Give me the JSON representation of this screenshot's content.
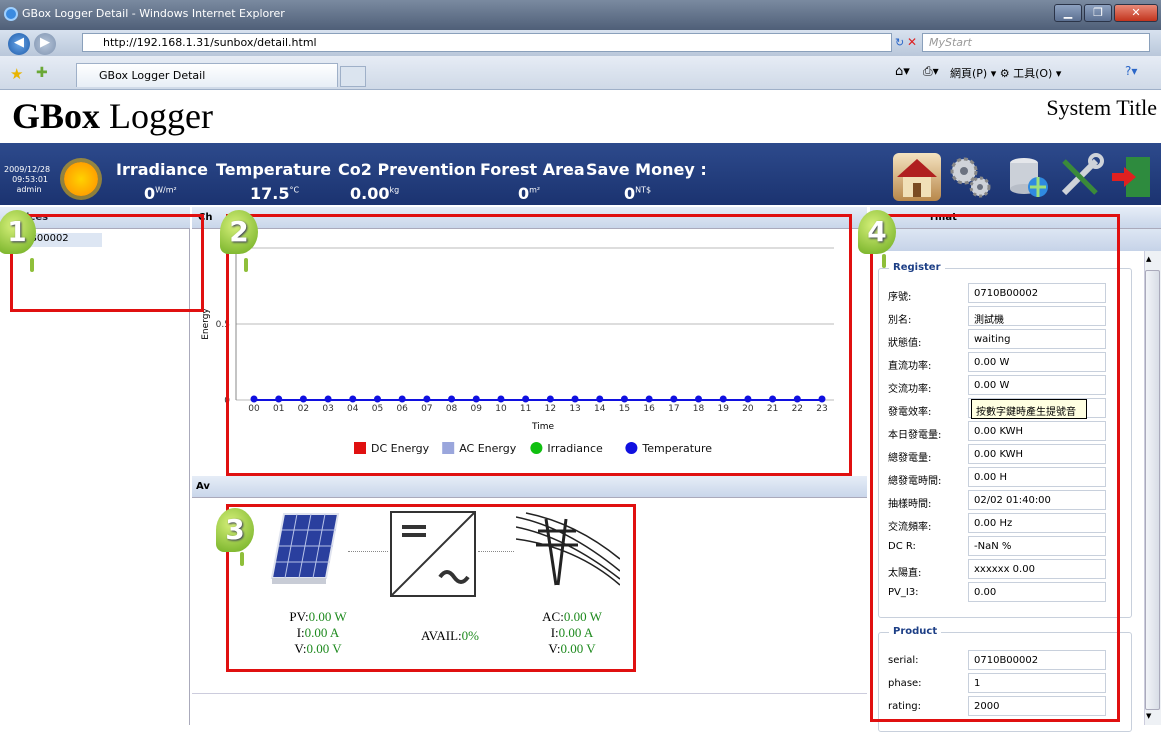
{
  "browser": {
    "window_title": "GBox Logger Detail - Windows Internet Explorer",
    "url": "http://192.168.1.31/sunbox/detail.html",
    "search_placeholder": "MyStart",
    "tab_title": "GBox Logger Detail",
    "command_bar": "網頁(P) ▾  ⚙ 工具(O) ▾"
  },
  "page": {
    "logo_bold": "GBox",
    "logo_rest": " Logger",
    "system_title": "System Title"
  },
  "header": {
    "date": "2009/12/28",
    "time": "09:53:01",
    "user": "admin",
    "metrics": [
      {
        "label": "Irradiance",
        "value": "0",
        "unit": "W/m²"
      },
      {
        "label": "Temperature",
        "value": "17.5",
        "unit": "°C"
      },
      {
        "label": "Co2 Prevention",
        "value": "0.00",
        "unit": "kg"
      },
      {
        "label": "Forest Area",
        "value": "0",
        "unit": "m²"
      },
      {
        "label": "Save Money :",
        "value": "0",
        "unit": "NT$"
      }
    ]
  },
  "devices": {
    "heading": "ices",
    "item": "B00002"
  },
  "chart_panel": {
    "heading": "Ch"
  },
  "chart_data": {
    "type": "line",
    "categories": [
      "00",
      "01",
      "02",
      "03",
      "04",
      "05",
      "06",
      "07",
      "08",
      "09",
      "10",
      "11",
      "12",
      "13",
      "14",
      "15",
      "16",
      "17",
      "18",
      "19",
      "20",
      "21",
      "22",
      "23"
    ],
    "series": [
      {
        "name": "DC Energy",
        "color": "#e01010",
        "values": [
          0,
          0,
          0,
          0,
          0,
          0,
          0,
          0,
          0,
          0,
          0,
          0,
          0,
          0,
          0,
          0,
          0,
          0,
          0,
          0,
          0,
          0,
          0,
          0
        ]
      },
      {
        "name": "AC Energy",
        "color": "#9aa6dc",
        "values": [
          0,
          0,
          0,
          0,
          0,
          0,
          0,
          0,
          0,
          0,
          0,
          0,
          0,
          0,
          0,
          0,
          0,
          0,
          0,
          0,
          0,
          0,
          0,
          0
        ]
      },
      {
        "name": "Irradiance",
        "color": "#10c010",
        "values": [
          0,
          0,
          0,
          0,
          0,
          0,
          0,
          0,
          0,
          0,
          0,
          0,
          0,
          0,
          0,
          0,
          0,
          0,
          0,
          0,
          0,
          0,
          0,
          0
        ]
      },
      {
        "name": "Temperature",
        "color": "#1010e0",
        "values": [
          0,
          0,
          0,
          0,
          0,
          0,
          0,
          0,
          0,
          0,
          0,
          0,
          0,
          0,
          0,
          0,
          0,
          0,
          0,
          0,
          0,
          0,
          0,
          0
        ]
      }
    ],
    "xlabel": "Time",
    "ylabel": "Energy",
    "ylim": [
      0,
      1
    ],
    "yticks": [
      "0",
      "0.5"
    ],
    "grid": true,
    "legend": "bottom"
  },
  "avail": {
    "heading": "Av",
    "pv_power": "0.00 W",
    "pv_current": "0.00 A",
    "pv_voltage": "0.00 V",
    "avail": "0%",
    "ac_power": "0.00 W",
    "ac_current": "0.00 A",
    "ac_voltage": "0.00 V",
    "pv_label": "PV:",
    "i_label": "I:",
    "v_label": "V:",
    "avail_label": "AVAIL:",
    "ac_label": "AC:"
  },
  "right": {
    "heading": "rmat",
    "register_legend": "Register",
    "register": [
      {
        "label": "序號:",
        "value": "0710B00002"
      },
      {
        "label": "別名:",
        "value": "測試機"
      },
      {
        "label": "狀態值:",
        "value": "waiting"
      },
      {
        "label": "直流功率:",
        "value": "0.00 W"
      },
      {
        "label": "交流功率:",
        "value": "0.00 W"
      },
      {
        "label": "發電效率:",
        "value": ""
      },
      {
        "label": "本日發電量:",
        "value": "0.00 KWH"
      },
      {
        "label": "總發電量:",
        "value": "0.00 KWH"
      },
      {
        "label": "總發電時間:",
        "value": "0.00 H"
      },
      {
        "label": "抽樣時間:",
        "value": "02/02 01:40:00"
      },
      {
        "label": "交流頻率:",
        "value": "0.00 Hz"
      },
      {
        "label": "DC R:",
        "value": "-NaN %"
      },
      {
        "label": "太陽直:",
        "value": "xxxxxx   0.00"
      },
      {
        "label": "PV_I3:",
        "value": "0.00"
      }
    ],
    "tooltip": "按數字鍵時產生提號音",
    "product_legend": "Product",
    "product": [
      {
        "label": "serial:",
        "value": "0710B00002"
      },
      {
        "label": "phase:",
        "value": "1"
      },
      {
        "label": "rating:",
        "value": "2000"
      }
    ]
  },
  "markers": [
    "1",
    "2",
    "3",
    "4"
  ]
}
